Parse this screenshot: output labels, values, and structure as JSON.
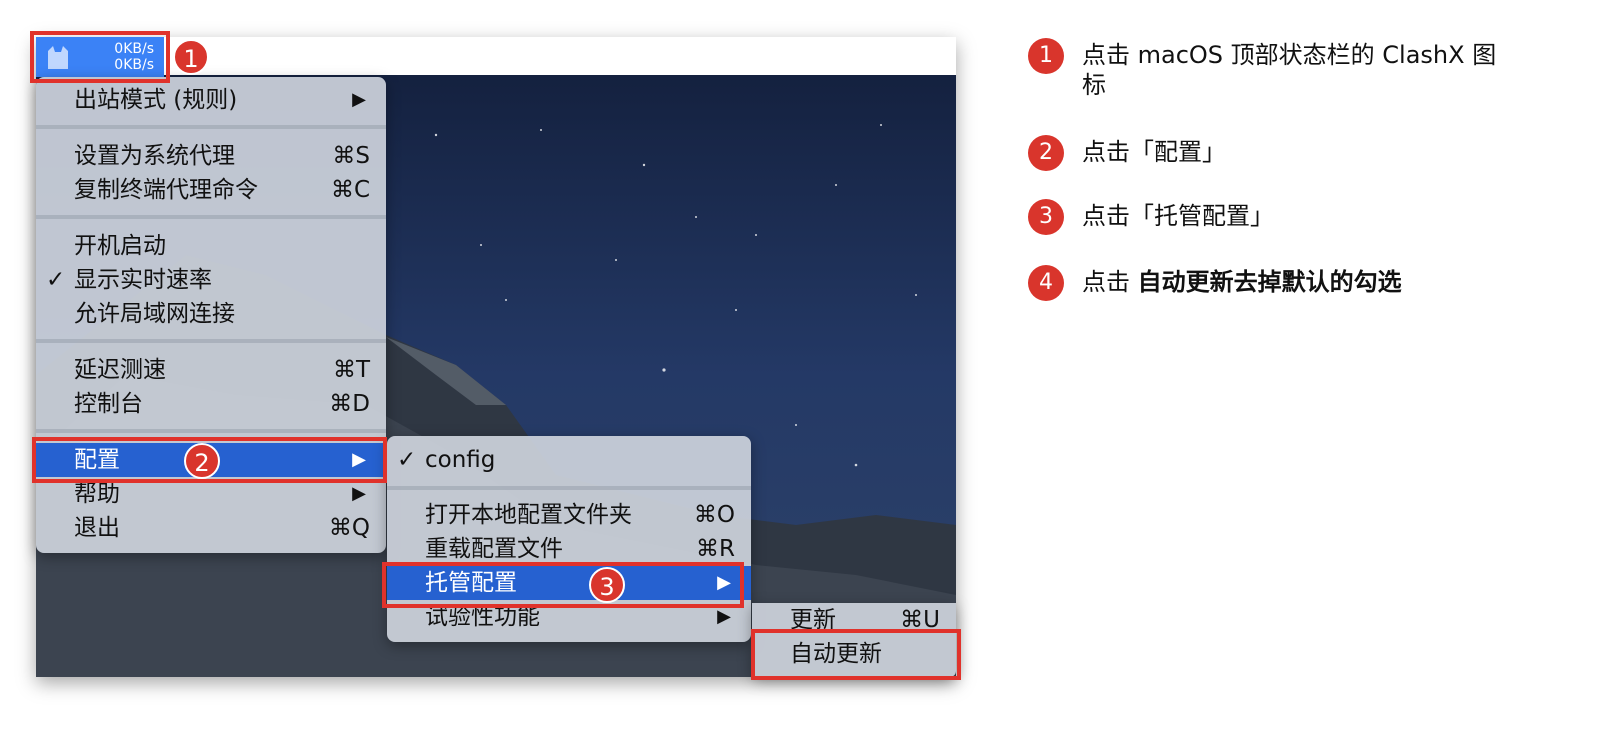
{
  "status_item": {
    "upload_speed": "0KB/s",
    "download_speed": "0KB/s",
    "icon": "clashx-cat-icon",
    "color": "#3b82f6"
  },
  "main_menu": {
    "outbound_mode": {
      "label": "出站模式 (规则)",
      "arrow": "▶"
    },
    "set_system_proxy": {
      "label": "设置为系统代理",
      "shortcut": "⌘S"
    },
    "copy_terminal_cmd": {
      "label": "复制终端代理命令",
      "shortcut": "⌘C"
    },
    "launch_at_login": {
      "label": "开机启动"
    },
    "show_speed": {
      "label": "显示实时速率",
      "check": "✓"
    },
    "allow_lan": {
      "label": "允许局域网连接"
    },
    "latency_test": {
      "label": "延迟测速",
      "shortcut": "⌘T"
    },
    "dashboard": {
      "label": "控制台",
      "shortcut": "⌘D"
    },
    "config": {
      "label": "配置",
      "arrow": "▶"
    },
    "help": {
      "label": "帮助",
      "arrow": "▶"
    },
    "quit": {
      "label": "退出",
      "shortcut": "⌘Q"
    }
  },
  "config_menu": {
    "current": {
      "label": "config",
      "check": "✓"
    },
    "open_folder": {
      "label": "打开本地配置文件夹",
      "shortcut": "⌘O"
    },
    "reload": {
      "label": "重载配置文件",
      "shortcut": "⌘R"
    },
    "managed": {
      "label": "托管配置",
      "arrow": "▶"
    },
    "experimental": {
      "label": "试验性功能",
      "arrow": "▶"
    }
  },
  "managed_menu": {
    "update": {
      "label": "更新",
      "shortcut": "⌘U"
    },
    "auto_update": {
      "label": "自动更新"
    }
  },
  "badges": [
    "1",
    "2",
    "3"
  ],
  "steps": [
    {
      "num": "1",
      "text": "点击 macOS 顶部状态栏的 ClashX 图标"
    },
    {
      "num": "2",
      "text": "点击「配置」"
    },
    {
      "num": "3",
      "text": "点击「托管配置」"
    },
    {
      "num": "4",
      "text": "点击 ",
      "emphasis": "自动更新去掉默认的勾选"
    }
  ],
  "colors": {
    "highlight": "#e0322b",
    "badge": "#d9352c",
    "menu_selected": "#2661d0"
  }
}
